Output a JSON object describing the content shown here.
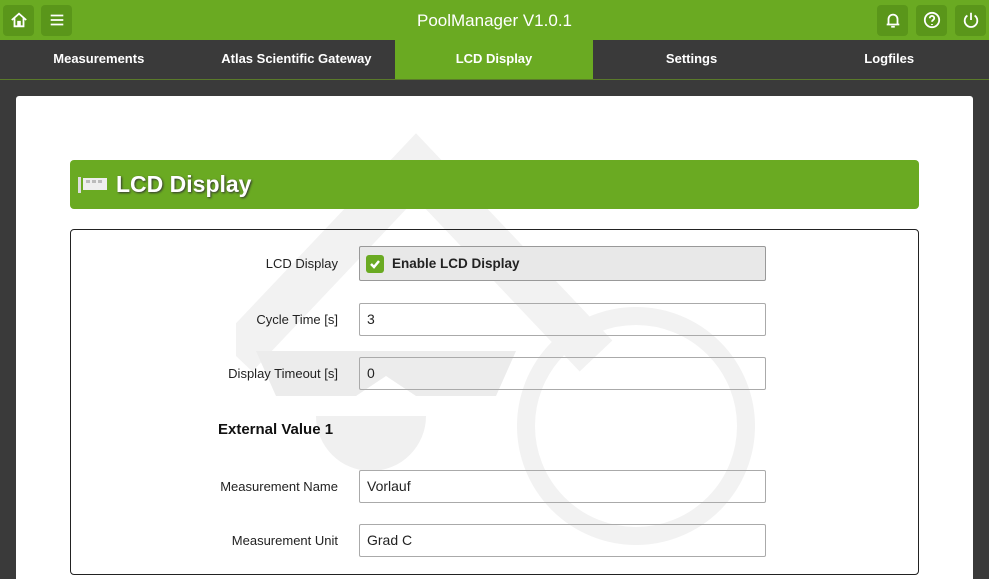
{
  "app": {
    "title": "PoolManager V1.0.1"
  },
  "nav": {
    "tabs": [
      "Measurements",
      "Atlas Scientific Gateway",
      "LCD Display",
      "Settings",
      "Logfiles"
    ],
    "active": "LCD Display"
  },
  "page": {
    "heading": "LCD Display"
  },
  "form": {
    "lcd_label": "LCD Display",
    "lcd_checkbox": "Enable LCD Display",
    "lcd_checked": true,
    "cycle_label": "Cycle Time [s]",
    "cycle_value": "3",
    "timeout_label": "Display Timeout [s]",
    "timeout_value": "0",
    "section": "External Value 1",
    "mname_label": "Measurement Name",
    "mname_value": "Vorlauf",
    "munit_label": "Measurement Unit",
    "munit_value": "Grad C"
  },
  "colors": {
    "accent": "#6aaa22",
    "nav_bg": "#3a3a3a"
  }
}
